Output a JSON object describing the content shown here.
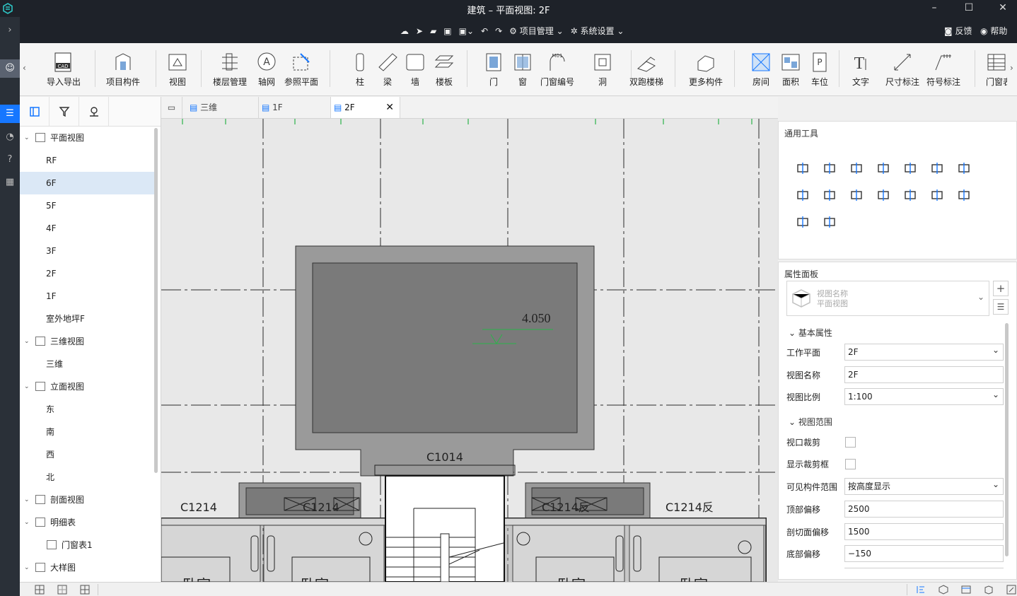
{
  "window": {
    "title": "建筑 – 平面视图: 2F"
  },
  "menubar": {
    "tab": "建筑",
    "project_mgmt": "项目管理",
    "sys_settings": "系统设置",
    "feedback": "反馈",
    "help": "帮助"
  },
  "ribbon": {
    "items": [
      "导入导出",
      "项目构件",
      "视图",
      "楼层管理",
      "轴网",
      "参照平面",
      "柱",
      "梁",
      "墙",
      "楼板",
      "门",
      "窗",
      "门窗编号",
      "洞",
      "双跑楼梯",
      "更多构件",
      "房间",
      "面积",
      "车位",
      "文字",
      "尺寸标注",
      "符号标注",
      "门窗表"
    ]
  },
  "tree": {
    "items": [
      {
        "label": "平面视图",
        "level": 0
      },
      {
        "label": "RF",
        "level": 1
      },
      {
        "label": "6F",
        "level": 1
      },
      {
        "label": "5F",
        "level": 1
      },
      {
        "label": "4F",
        "level": 1
      },
      {
        "label": "3F",
        "level": 1
      },
      {
        "label": "2F",
        "level": 1
      },
      {
        "label": "1F",
        "level": 1
      },
      {
        "label": "室外地坪F",
        "level": 1
      },
      {
        "label": "三维视图",
        "level": 0
      },
      {
        "label": "三维",
        "level": 1
      },
      {
        "label": "立面视图",
        "level": 0
      },
      {
        "label": "东",
        "level": 1
      },
      {
        "label": "南",
        "level": 1
      },
      {
        "label": "西",
        "level": 1
      },
      {
        "label": "北",
        "level": 1
      },
      {
        "label": "剖面视图",
        "level": 0
      },
      {
        "label": "明细表",
        "level": 0
      },
      {
        "label": "门窗表1",
        "level": 2
      },
      {
        "label": "大样图",
        "level": 0
      }
    ]
  },
  "tabs": [
    {
      "label": "三维"
    },
    {
      "label": "1F"
    },
    {
      "label": "2F"
    }
  ],
  "drawing": {
    "elev": "4.050",
    "c1014": "C1014",
    "c1214a": "C1214",
    "c1214b": "C1214",
    "c1214c": "C1214反",
    "c1214d": "C1214反",
    "room1": "卧室",
    "room2": "卧室",
    "room3": "卧室",
    "room4": "卧室"
  },
  "tools": {
    "title": "通用工具"
  },
  "props": {
    "title": "属性面板",
    "type_name": "视图名称",
    "type_value": "平面视图",
    "basic": "基本属性",
    "work_plane_label": "工作平面",
    "work_plane": "2F",
    "view_name_label": "视图名称",
    "view_name": "2F",
    "scale_label": "视图比例",
    "scale": "1:100",
    "range": "视图范围",
    "crop_label": "视口裁剪",
    "show_crop_label": "显示裁剪框",
    "visible_label": "可见构件范围",
    "visible": "按高度显示",
    "top_label": "顶部偏移",
    "top": "2500",
    "cut_label": "剖切面偏移",
    "cut": "1500",
    "bottom_label": "底部偏移",
    "bottom": "−150"
  }
}
